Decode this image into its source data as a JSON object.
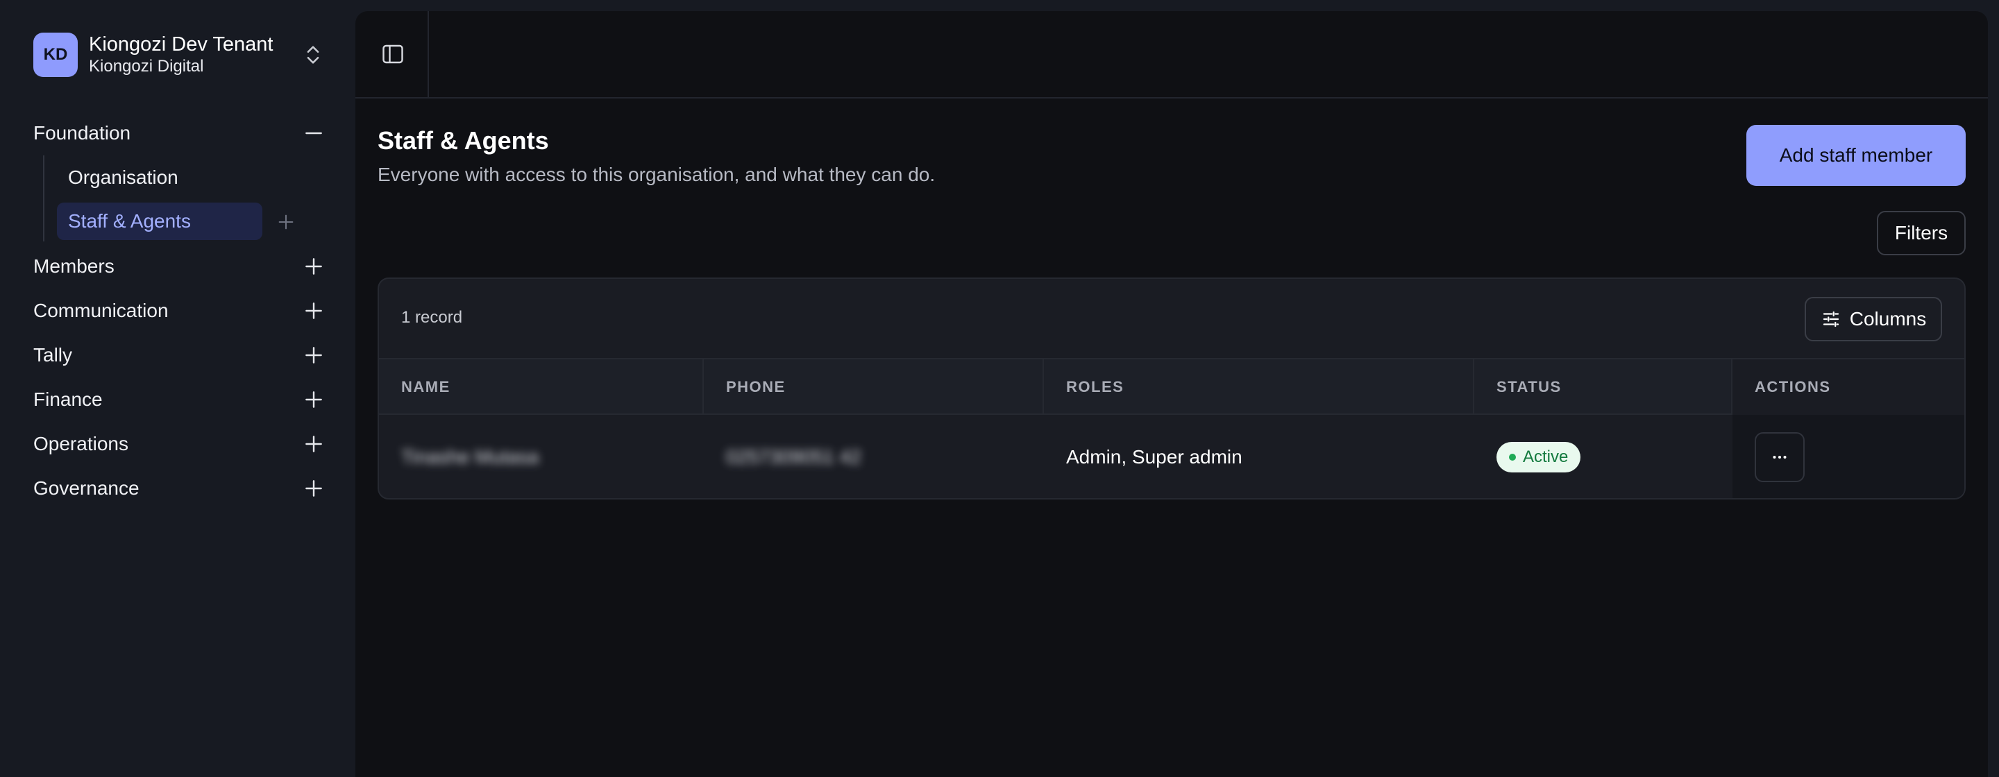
{
  "tenant": {
    "initials": "KD",
    "name": "Kiongozi Dev Tenant",
    "org": "Kiongozi Digital"
  },
  "sidebar": {
    "sections": [
      {
        "label": "Foundation",
        "expanded": true
      },
      {
        "label": "Members",
        "expanded": false
      },
      {
        "label": "Communication",
        "expanded": false
      },
      {
        "label": "Tally",
        "expanded": false
      },
      {
        "label": "Finance",
        "expanded": false
      },
      {
        "label": "Operations",
        "expanded": false
      },
      {
        "label": "Governance",
        "expanded": false
      }
    ],
    "foundation_items": [
      {
        "label": "Organisation",
        "active": false
      },
      {
        "label": "Staff & Agents",
        "active": true
      }
    ]
  },
  "page": {
    "title": "Staff & Agents",
    "subtitle": "Everyone with access to this organisation, and what they can do.",
    "add_button": "Add staff member",
    "filters_button": "Filters"
  },
  "table": {
    "record_count": "1 record",
    "columns_button": "Columns",
    "headers": [
      "NAME",
      "PHONE",
      "ROLES",
      "STATUS",
      "ACTIONS"
    ],
    "rows": [
      {
        "name": "Tinashe Mutasa",
        "phone": "0257309051 42",
        "roles": "Admin, Super admin",
        "status": "Active"
      }
    ]
  },
  "colors": {
    "accent": "#8f9dfd",
    "status_active_bg": "#e9f9ee",
    "status_active_text": "#137a3e"
  },
  "icons": {
    "switcher": "chevron-up-down-icon",
    "panel_toggle": "sidebar-panel-icon",
    "expanded": "minus-icon",
    "collapsed": "plus-icon",
    "columns": "sliders-icon",
    "actions": "more-horizontal-icon"
  }
}
